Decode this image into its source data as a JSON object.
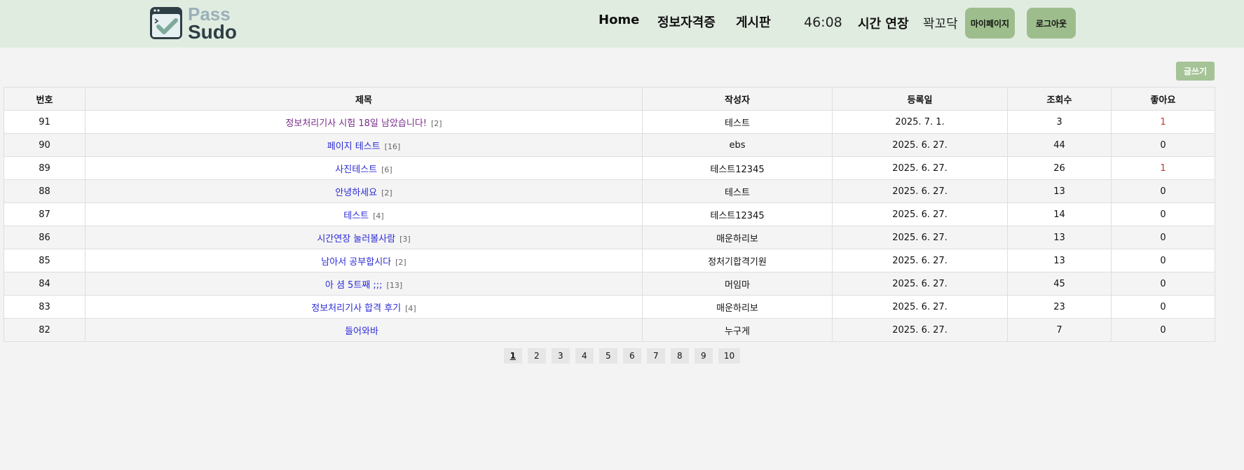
{
  "logo": {
    "line1": "Pass",
    "line2": "Sudo"
  },
  "nav": {
    "home": "Home",
    "certs": "정보자격증",
    "board": "게시판"
  },
  "header": {
    "timer": "46:08",
    "extend": "시간 연장",
    "username": "꽉꼬닥",
    "mypage": "마이페이지",
    "logout": "로그아웃"
  },
  "write_button": "글쓰기",
  "table": {
    "headers": [
      "번호",
      "제목",
      "작성자",
      "등록일",
      "조회수",
      "좋아요"
    ],
    "rows": [
      {
        "no": "91",
        "title": "정보처리기사 시험 18일 남았습니다!",
        "comments": "[2]",
        "author": "테스트",
        "date": "2025. 7. 1.",
        "views": "3",
        "likes": "1"
      },
      {
        "no": "90",
        "title": "페이지 테스트",
        "comments": "[16]",
        "author": "ebs",
        "date": "2025. 6. 27.",
        "views": "44",
        "likes": "0"
      },
      {
        "no": "89",
        "title": "사진테스트",
        "comments": "[6]",
        "author": "테스트12345",
        "date": "2025. 6. 27.",
        "views": "26",
        "likes": "1"
      },
      {
        "no": "88",
        "title": "안녕하세요",
        "comments": "[2]",
        "author": "테스트",
        "date": "2025. 6. 27.",
        "views": "13",
        "likes": "0"
      },
      {
        "no": "87",
        "title": "테스트",
        "comments": "[4]",
        "author": "테스트12345",
        "date": "2025. 6. 27.",
        "views": "14",
        "likes": "0"
      },
      {
        "no": "86",
        "title": "시간연장 눌러볼사람",
        "comments": "[3]",
        "author": "매운하리보",
        "date": "2025. 6. 27.",
        "views": "13",
        "likes": "0"
      },
      {
        "no": "85",
        "title": "남아서 공부합시다",
        "comments": "[2]",
        "author": "정처기합격기원",
        "date": "2025. 6. 27.",
        "views": "13",
        "likes": "0"
      },
      {
        "no": "84",
        "title": "아 셤 5트째 ;;;",
        "comments": "[13]",
        "author": "머임마",
        "date": "2025. 6. 27.",
        "views": "45",
        "likes": "0"
      },
      {
        "no": "83",
        "title": "정보처리기사 합격 후기",
        "comments": "[4]",
        "author": "매운하리보",
        "date": "2025. 6. 27.",
        "views": "23",
        "likes": "0"
      },
      {
        "no": "82",
        "title": "들어와바",
        "comments": "",
        "author": "누구게",
        "date": "2025. 6. 27.",
        "views": "7",
        "likes": "0"
      }
    ]
  },
  "pagination": [
    "1",
    "2",
    "3",
    "4",
    "5",
    "6",
    "7",
    "8",
    "9",
    "10"
  ],
  "current_page": "1",
  "colors": {
    "header_bg": "#e1ece1",
    "button_green": "#9dbe8c",
    "link_blue": "#2b2bd6",
    "link_visited": "#7a2c8c",
    "likes_red": "#c0392b"
  }
}
